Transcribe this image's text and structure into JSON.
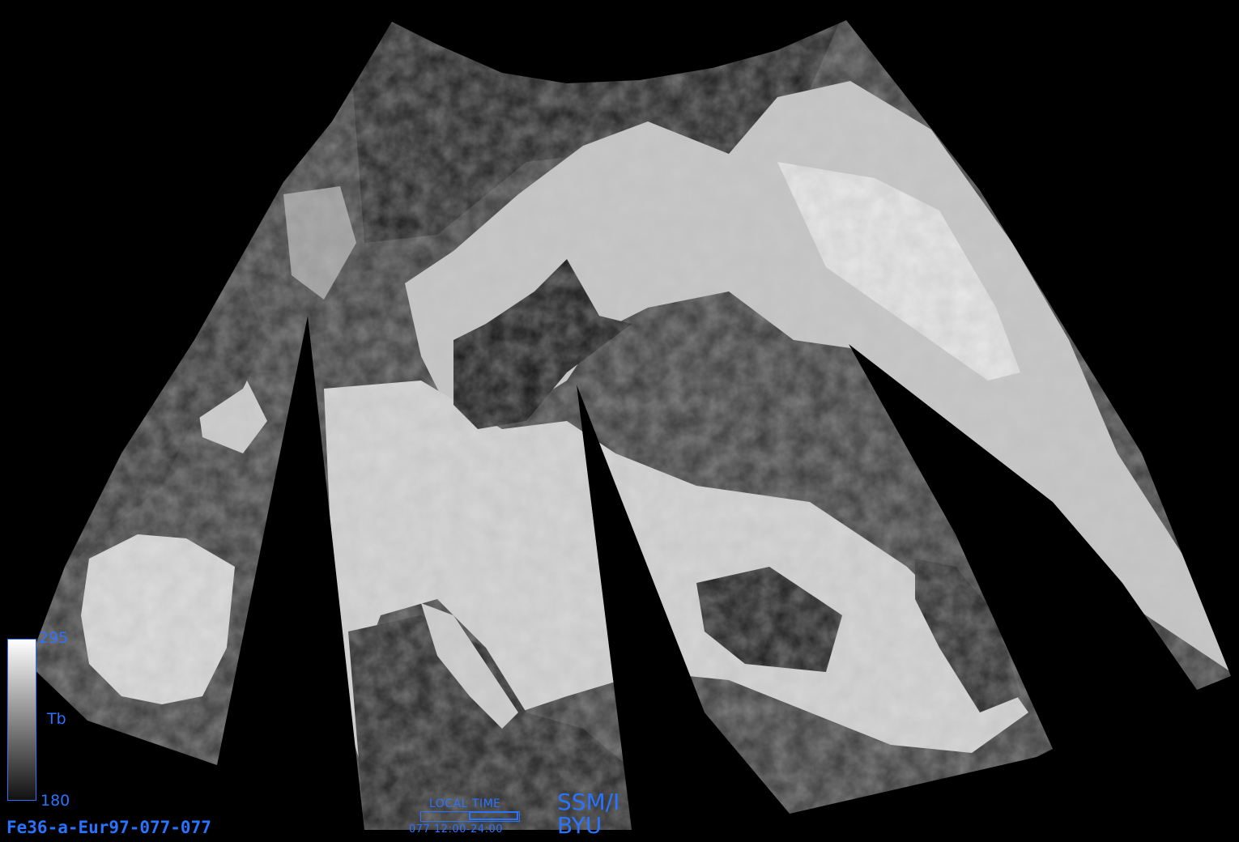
{
  "file_label": "Fe36-a-Eur97-077-077",
  "colorbar": {
    "variable": "Tb",
    "max": "295",
    "min": "180"
  },
  "local_time": {
    "label": "LOCAL TIME",
    "range": "077  12:00-24:00",
    "coverage_fraction": 0.5
  },
  "sensor": "SSM/I",
  "organization": "BYU",
  "colors": {
    "background": "#000000",
    "annotation": "#2a73ff",
    "colorbar_high": "#ffffff",
    "colorbar_low": "#111111"
  }
}
